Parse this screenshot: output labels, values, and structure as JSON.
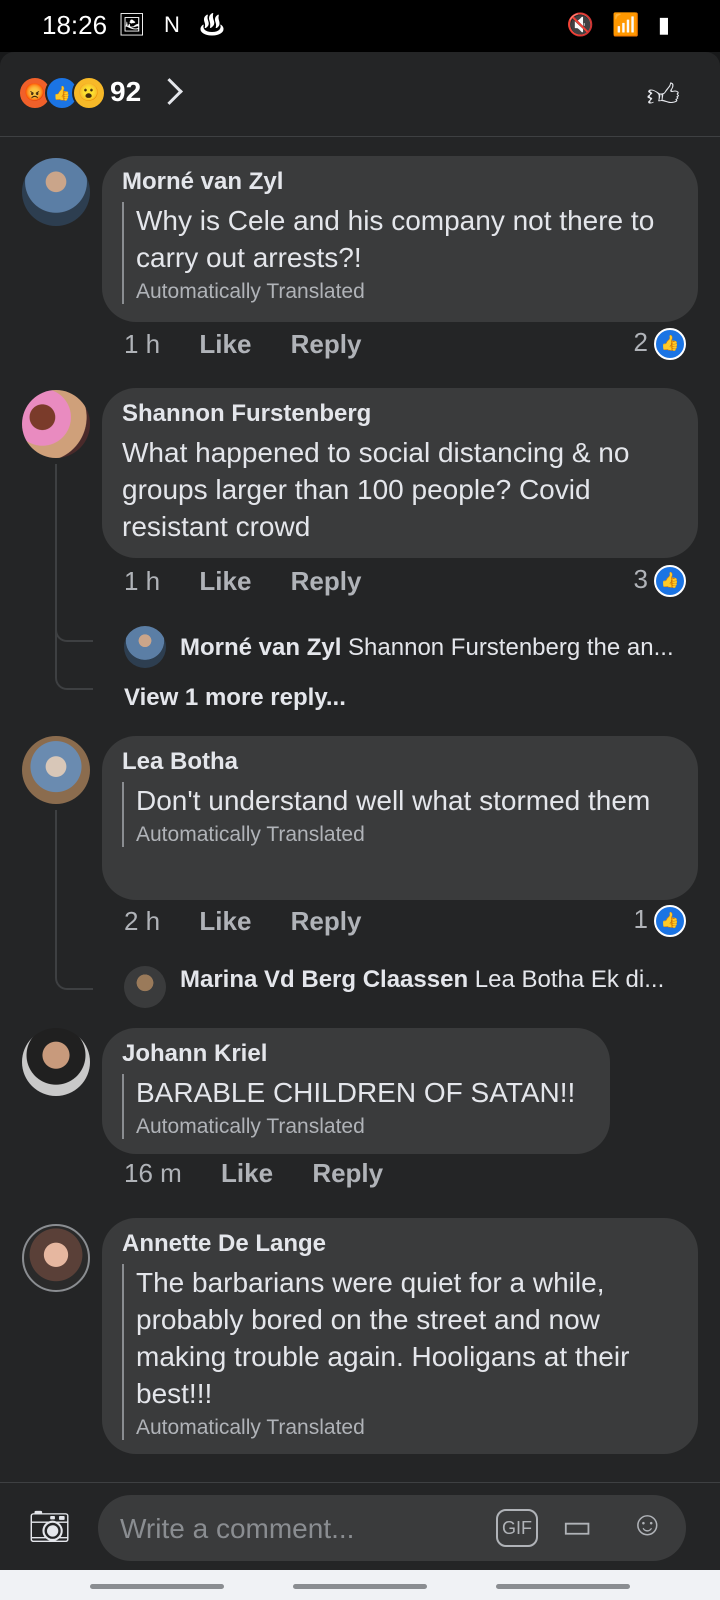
{
  "statusbar": {
    "time": "18:26",
    "left_icons": "🖼 N ♨",
    "right_icons": "🔇 📶 ▮"
  },
  "header": {
    "reaction_count": "92",
    "reactions": [
      "angry",
      "like",
      "wow"
    ],
    "like_icon": "thumbs-up-icon"
  },
  "comments": [
    {
      "name": "Morné van Zyl",
      "text": "Why is Cele and his company not there to carry out arrests?!",
      "translated": "Automatically Translated",
      "time": "1 h",
      "like": "Like",
      "reply": "Reply",
      "likes": "2"
    },
    {
      "name": "Shannon Furstenberg",
      "text": "What happened to social distancing & no groups larger than 100 people?  Covid resistant crowd",
      "translated": "",
      "time": "1 h",
      "like": "Like",
      "reply": "Reply",
      "likes": "3",
      "reply_preview": {
        "name": "Morné van Zyl",
        "text": "Shannon Furstenberg the an..."
      },
      "view_more": "View 1 more reply..."
    },
    {
      "name": "Lea Botha",
      "text": "Don't understand well what stormed them",
      "translated": "Automatically Translated",
      "time": "2 h",
      "like": "Like",
      "reply": "Reply",
      "likes": "1",
      "reply_preview": {
        "name": "Marina Vd Berg Claassen",
        "text": "Lea Botha Ek di..."
      }
    },
    {
      "name": "Johann Kriel",
      "text": "BARABLE CHILDREN OF SATAN!!",
      "translated": "Automatically Translated",
      "time": "16 m",
      "like": "Like",
      "reply": "Reply"
    },
    {
      "name": "Annette De Lange",
      "text": "The barbarians were quiet for a while, probably bored on the street and now making trouble again. Hooligans at their best!!!",
      "translated": "Automatically Translated"
    }
  ],
  "composer": {
    "placeholder": "Write a comment...",
    "gif": "GIF"
  }
}
